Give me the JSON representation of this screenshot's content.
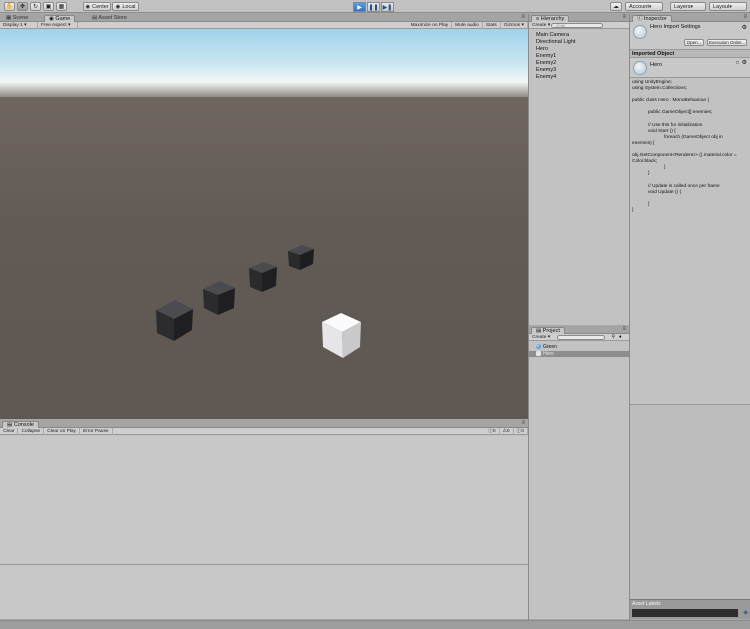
{
  "toolbar": {
    "pivot_label": "Center",
    "space_label": "Local",
    "account_label": "Account",
    "layers_label": "Layers",
    "layout_label": "Layout"
  },
  "game_panel": {
    "tabs": [
      "Scene",
      "Game",
      "Asset Store"
    ],
    "display_label": "Display 1",
    "aspect_label": "Free Aspect",
    "toggles": [
      "Maximize on Play",
      "Mute audio",
      "Stats",
      "Gizmos"
    ]
  },
  "hierarchy": {
    "tab_label": "Hierarchy",
    "create_label": "Create",
    "search_placeholder": "Q*All",
    "items": [
      "Main Camera",
      "Directional Light",
      "Hero",
      "Enemy1",
      "Enemy2",
      "Enemy3",
      "Enemy4"
    ]
  },
  "project": {
    "tab_label": "Project",
    "create_label": "Create",
    "items": [
      {
        "label": "Green",
        "selected": false
      },
      {
        "label": "Hero",
        "selected": true
      }
    ]
  },
  "inspector": {
    "tab_label": "Inspector",
    "title": "Hero Import Settings",
    "open_button": "Open...",
    "execution_order_button": "Execution Order...",
    "section_label": "Imported Object",
    "object_name": "Hero",
    "code_lines": [
      "using UnityEngine;",
      "using System.Collections;",
      "",
      "public class Hero : MonoBehaviour {",
      "",
      "            public GameObject[] enemies;",
      "",
      "            // Use this for initialization",
      "            void Start () {",
      "                        foreach (GameObject obj in",
      "enemies) {",
      "",
      "obj.GetComponent<Renderer> ().material.color =",
      "Color.black;",
      "                        }",
      "            }",
      "",
      "            // Update is called once per frame",
      "            void Update () {",
      "",
      "            }",
      "}"
    ],
    "asset_labels": "Asset Labels"
  },
  "console": {
    "tab_label": "Console",
    "buttons": [
      "Clear",
      "Collapse",
      "Clear on Play",
      "Error Pause"
    ],
    "counts": [
      "0",
      "0",
      "0"
    ]
  },
  "scene": {
    "cubes": [
      {
        "name": "enemy-cube-1",
        "color": "dark"
      },
      {
        "name": "enemy-cube-2",
        "color": "dark"
      },
      {
        "name": "enemy-cube-3",
        "color": "dark"
      },
      {
        "name": "enemy-cube-4",
        "color": "dark"
      },
      {
        "name": "hero-cube",
        "color": "white"
      }
    ]
  },
  "colors": {
    "accent_play": "#3d7fc9",
    "panel_bg": "#c2c2c2",
    "ground": "#625a55",
    "selection": "#8e8e8e"
  }
}
